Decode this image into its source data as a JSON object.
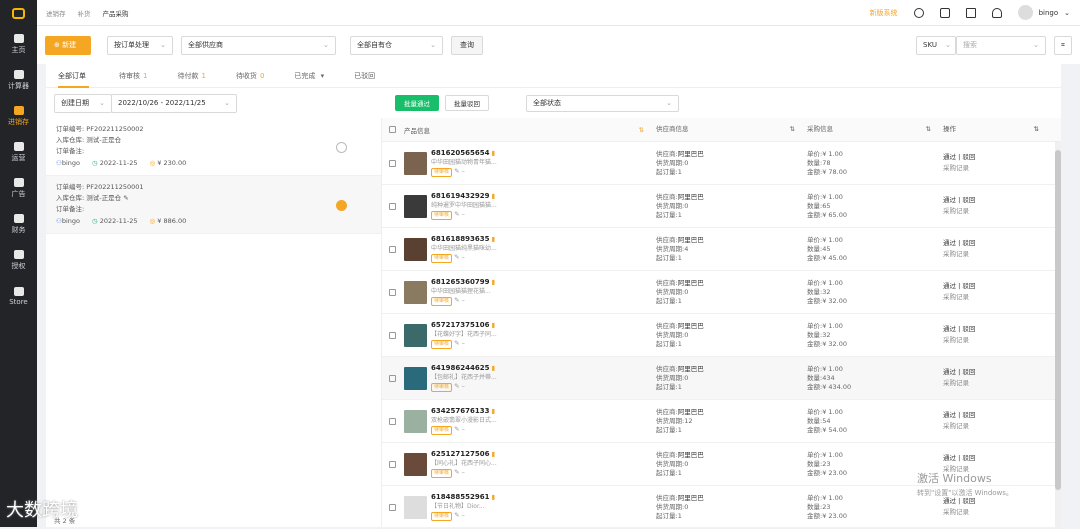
{
  "sidebar": {
    "items": [
      {
        "label": "主页"
      },
      {
        "label": "计算器"
      },
      {
        "label": "进销存"
      },
      {
        "label": "运营"
      },
      {
        "label": "广告"
      },
      {
        "label": "财务"
      },
      {
        "label": "授权"
      },
      {
        "label": "Store"
      }
    ]
  },
  "topbar": {
    "breadcrumb": [
      "进销存",
      "补货",
      "产品采购"
    ],
    "new_version": "新版系统",
    "user": "bingo"
  },
  "filters": {
    "new_button": "新建",
    "mode": "按订单处理",
    "supplier": "全部供应商",
    "warehouse": "全部自有仓",
    "query_button": "查询",
    "sku_type": "SKU",
    "search_placeholder": "搜索"
  },
  "tabs": [
    {
      "label": "全部订单",
      "count": ""
    },
    {
      "label": "待审核",
      "count": "1"
    },
    {
      "label": "待付款",
      "count": "1"
    },
    {
      "label": "待收货",
      "count": "0"
    },
    {
      "label": "已完成",
      "count": ""
    },
    {
      "label": "已驳回",
      "count": ""
    }
  ],
  "subbar": {
    "date_type": "创建日期",
    "date_range": "2022/10/26 - 2022/11/25",
    "batch_pass": "批量通过",
    "batch_reject": "批量驳回",
    "status": "全部状态"
  },
  "orders": [
    {
      "no_label": "订单编号:",
      "no": "PF202211250002",
      "wh_label": "入库仓库:",
      "wh": "测试-正是仓",
      "note_label": "订单备注:",
      "user": "bingo",
      "date": "2022-11-25",
      "amount": "¥ 230.00"
    },
    {
      "no_label": "订单编号:",
      "no": "PF202211250001",
      "wh_label": "入库仓库:",
      "wh": "测试-正是仓",
      "note_label": "订单备注:",
      "user": "bingo",
      "date": "2022-11-25",
      "amount": "¥ 886.00"
    }
  ],
  "total": "共 2 条",
  "table": {
    "headers": [
      "产品信息",
      "供应商信息",
      "采购信息",
      "操作"
    ],
    "rows": [
      {
        "sku": "681620565654",
        "title": "中华田园猫动物青年猫...",
        "badge": "待审核",
        "supplier": "阿里巴巴",
        "cycle": "0",
        "moq": "1",
        "price": "¥ 1.00",
        "qty": "78",
        "amount": "¥ 78.00",
        "thumb": "#7a6450"
      },
      {
        "sku": "681619432929",
        "title": "纯种暹罗中华田园猫猫...",
        "badge": "待审核",
        "supplier": "阿里巴巴",
        "cycle": "0",
        "moq": "1",
        "price": "¥ 1.00",
        "qty": "65",
        "amount": "¥ 65.00",
        "thumb": "#3a3a3a"
      },
      {
        "sku": "681618893635",
        "title": "中华田园猫纯黑猫咪幼...",
        "badge": "待审核",
        "supplier": "阿里巴巴",
        "cycle": "4",
        "moq": "1",
        "price": "¥ 1.00",
        "qty": "45",
        "amount": "¥ 45.00",
        "thumb": "#5a4030"
      },
      {
        "sku": "681265360799",
        "title": "中华田园猫猫狸花猫...",
        "badge": "待审核",
        "supplier": "阿里巴巴",
        "cycle": "0",
        "moq": "1",
        "price": "¥ 1.00",
        "qty": "32",
        "amount": "¥ 32.00",
        "thumb": "#8a7a60"
      },
      {
        "sku": "657217375106",
        "title": "【花蝶好字】花西子同...",
        "badge": "待审核",
        "supplier": "阿里巴巴",
        "cycle": "0",
        "moq": "1",
        "price": "¥ 1.00",
        "qty": "32",
        "amount": "¥ 32.00",
        "thumb": "#3a6a6a"
      },
      {
        "sku": "641986244625",
        "title": "【包邮礼】花西子并蒂...",
        "badge": "待审核",
        "supplier": "阿里巴巴",
        "cycle": "0",
        "moq": "1",
        "price": "¥ 1.00",
        "qty": "434",
        "amount": "¥ 434.00",
        "thumb": "#2a6a7a"
      },
      {
        "sku": "634257676133",
        "title": "双枪嵌翡翠小漫影日式...",
        "badge": "待审核",
        "supplier": "阿里巴巴",
        "cycle": "12",
        "moq": "1",
        "price": "¥ 1.00",
        "qty": "54",
        "amount": "¥ 54.00",
        "thumb": "#9ab0a0"
      },
      {
        "sku": "625127127506",
        "title": "【同心礼】花西子同心...",
        "badge": "待审核",
        "supplier": "阿里巴巴",
        "cycle": "0",
        "moq": "1",
        "price": "¥ 1.00",
        "qty": "23",
        "amount": "¥ 23.00",
        "thumb": "#6a4a3a"
      },
      {
        "sku": "618488552961",
        "title": "【节日礼物】Dior...",
        "badge": "待审核",
        "supplier": "阿里巴巴",
        "cycle": "0",
        "moq": "1",
        "price": "¥ 1.00",
        "qty": "23",
        "amount": "¥ 23.00",
        "thumb": "#ddd"
      }
    ],
    "supplier_label": "供应商:",
    "cycle_label": "供货周期:",
    "moq_label": "起订量:",
    "price_label": "单价:",
    "qty_label": "数量:",
    "amount_label": "金额:",
    "pass": "通过",
    "reject": "驳回",
    "record": "采购记录"
  },
  "watermarks": {
    "brand": "大数跨境",
    "win_title": "激活 Windows",
    "win_sub": "转到\"设置\"以激活 Windows。"
  }
}
